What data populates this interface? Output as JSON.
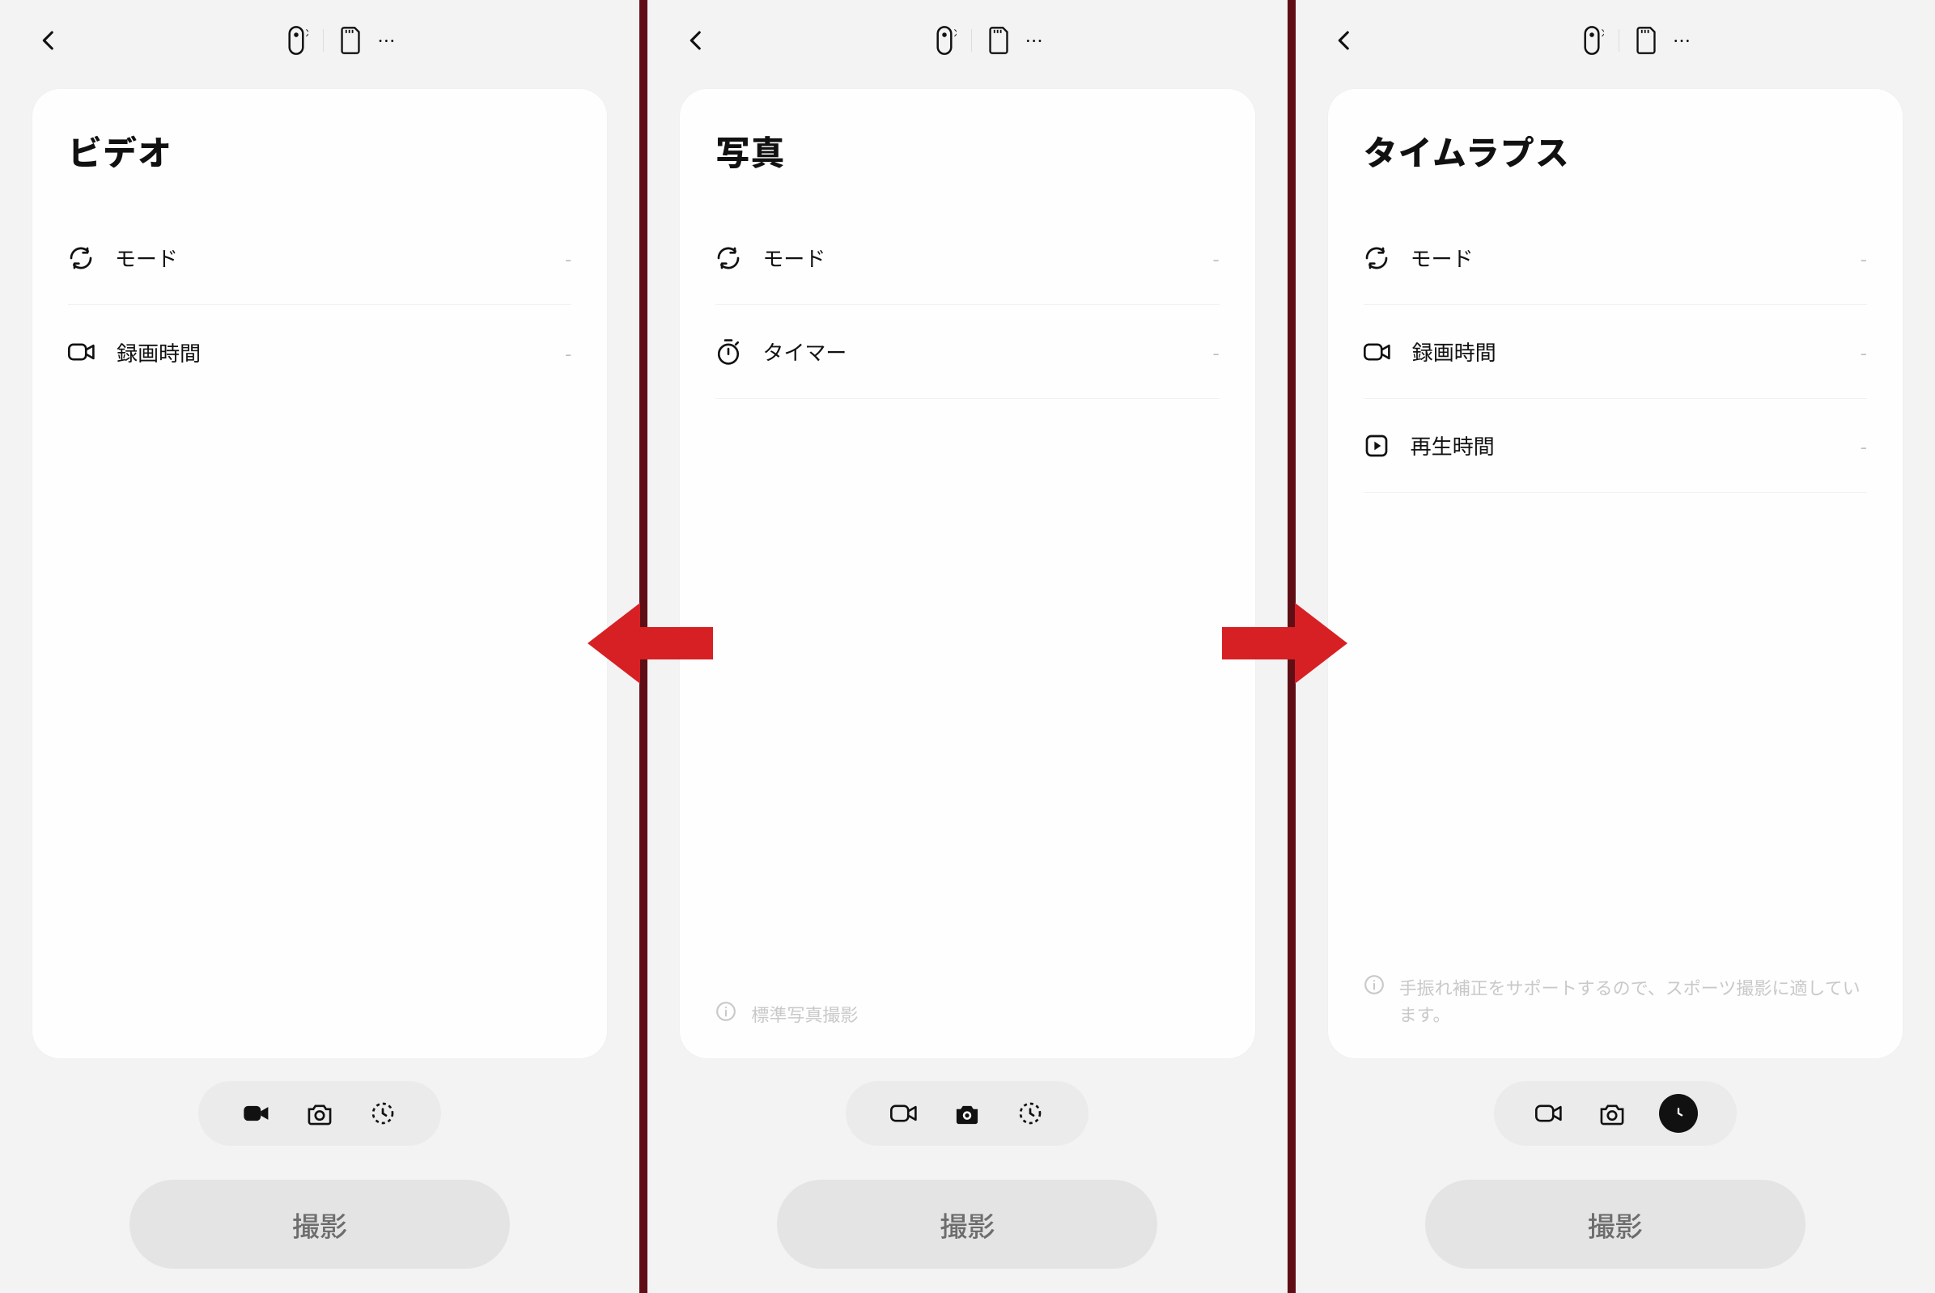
{
  "screens": [
    {
      "title": "ビデオ",
      "settings": [
        {
          "icon": "cycle",
          "label": "モード",
          "value": "-"
        },
        {
          "icon": "video",
          "label": "録画時間",
          "value": "-"
        }
      ],
      "note": "",
      "activeMode": 0,
      "shootLabel": "撮影"
    },
    {
      "title": "写真",
      "settings": [
        {
          "icon": "cycle",
          "label": "モード",
          "value": "-"
        },
        {
          "icon": "timer",
          "label": "タイマー",
          "value": "-"
        }
      ],
      "note": "標準写真撮影",
      "activeMode": 1,
      "shootLabel": "撮影"
    },
    {
      "title": "タイムラプス",
      "settings": [
        {
          "icon": "cycle",
          "label": "モード",
          "value": "-"
        },
        {
          "icon": "video",
          "label": "録画時間",
          "value": "-"
        },
        {
          "icon": "play",
          "label": "再生時間",
          "value": "-"
        }
      ],
      "note": "手振れ補正をサポートするので、スポーツ撮影に適しています。",
      "activeMode": 2,
      "shootLabel": "撮影"
    }
  ]
}
